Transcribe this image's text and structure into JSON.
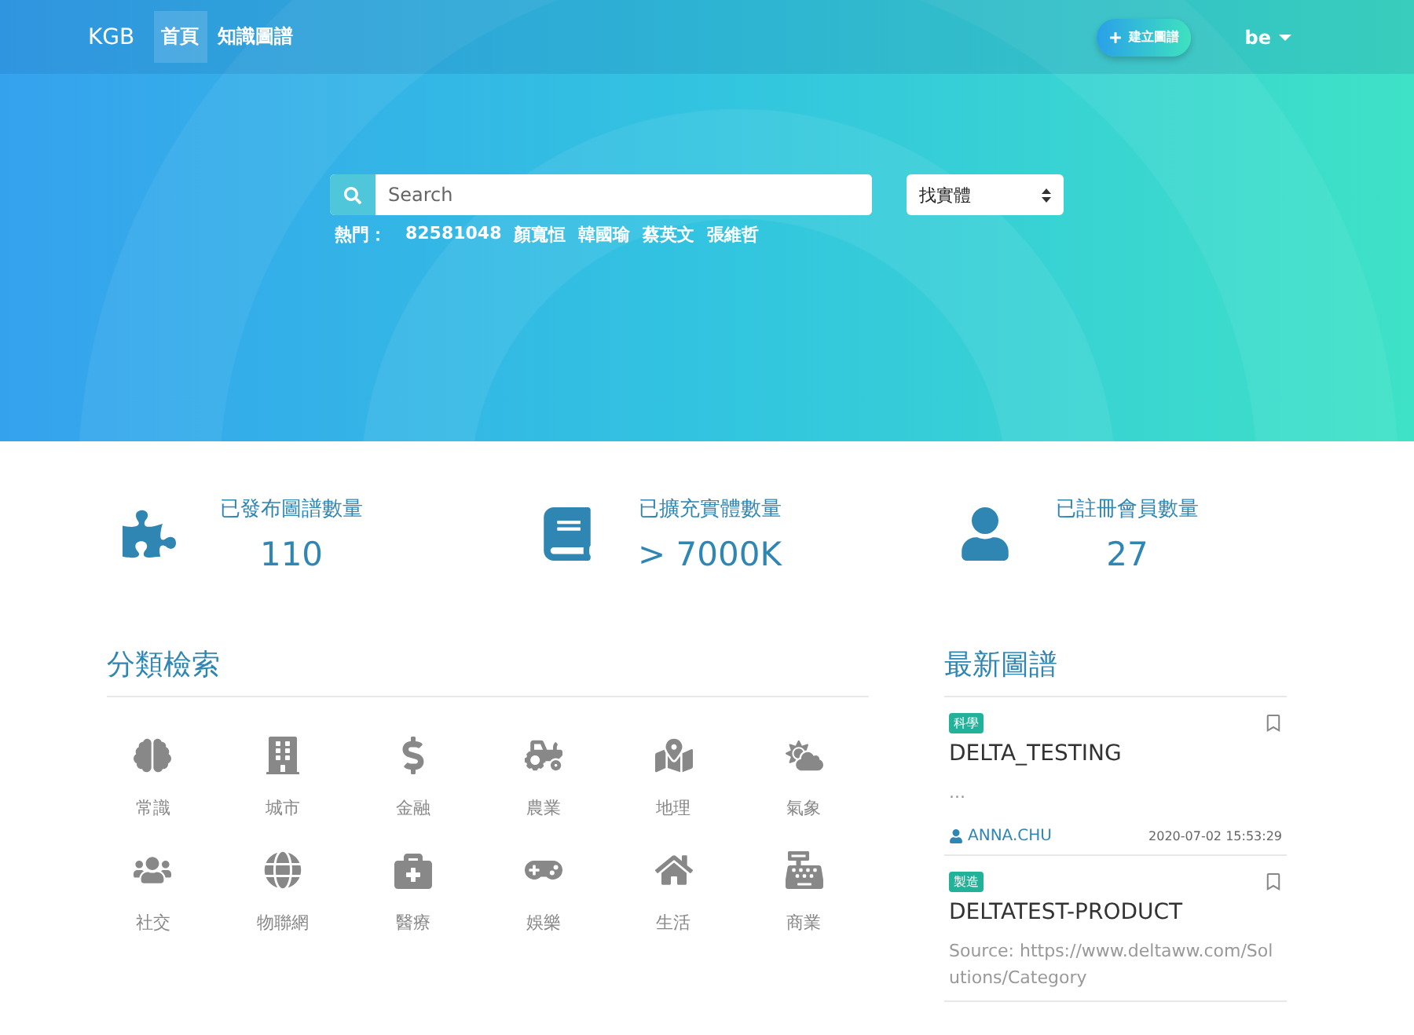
{
  "navbar": {
    "brand": "KGB",
    "links": [
      {
        "label": "首頁",
        "selected": true
      },
      {
        "label": "知識圖譜",
        "selected": false
      }
    ],
    "create_button": "建立圖譜",
    "user": "be"
  },
  "search": {
    "placeholder": "Search",
    "select": "找實體",
    "hot_label": "熱門：",
    "hot_terms": [
      "82581048",
      "顏寬恒",
      "韓國瑜",
      "蔡英文",
      "張維哲"
    ]
  },
  "stats": [
    {
      "label": "已發布圖譜數量",
      "value": "110"
    },
    {
      "label": "已擴充實體數量",
      "value": "> 7000K"
    },
    {
      "label": "已註冊會員數量",
      "value": "27"
    }
  ],
  "categories": {
    "title": "分類檢索",
    "items": [
      "常識",
      "城市",
      "金融",
      "農業",
      "地理",
      "氣象",
      "社交",
      "物聯網",
      "醫療",
      "娛樂",
      "生活",
      "商業"
    ]
  },
  "latest": {
    "title": "最新圖譜",
    "cards": [
      {
        "tag": "科學",
        "title": "DELTA_TESTING",
        "description": "...",
        "author": "ANNA.CHU",
        "time": "2020-07-02 15:53:29"
      },
      {
        "tag": "製造",
        "title": "DELTATEST-PRODUCT",
        "description": "Source: https://www.deltaww.com/Solutions/Category"
      }
    ]
  }
}
